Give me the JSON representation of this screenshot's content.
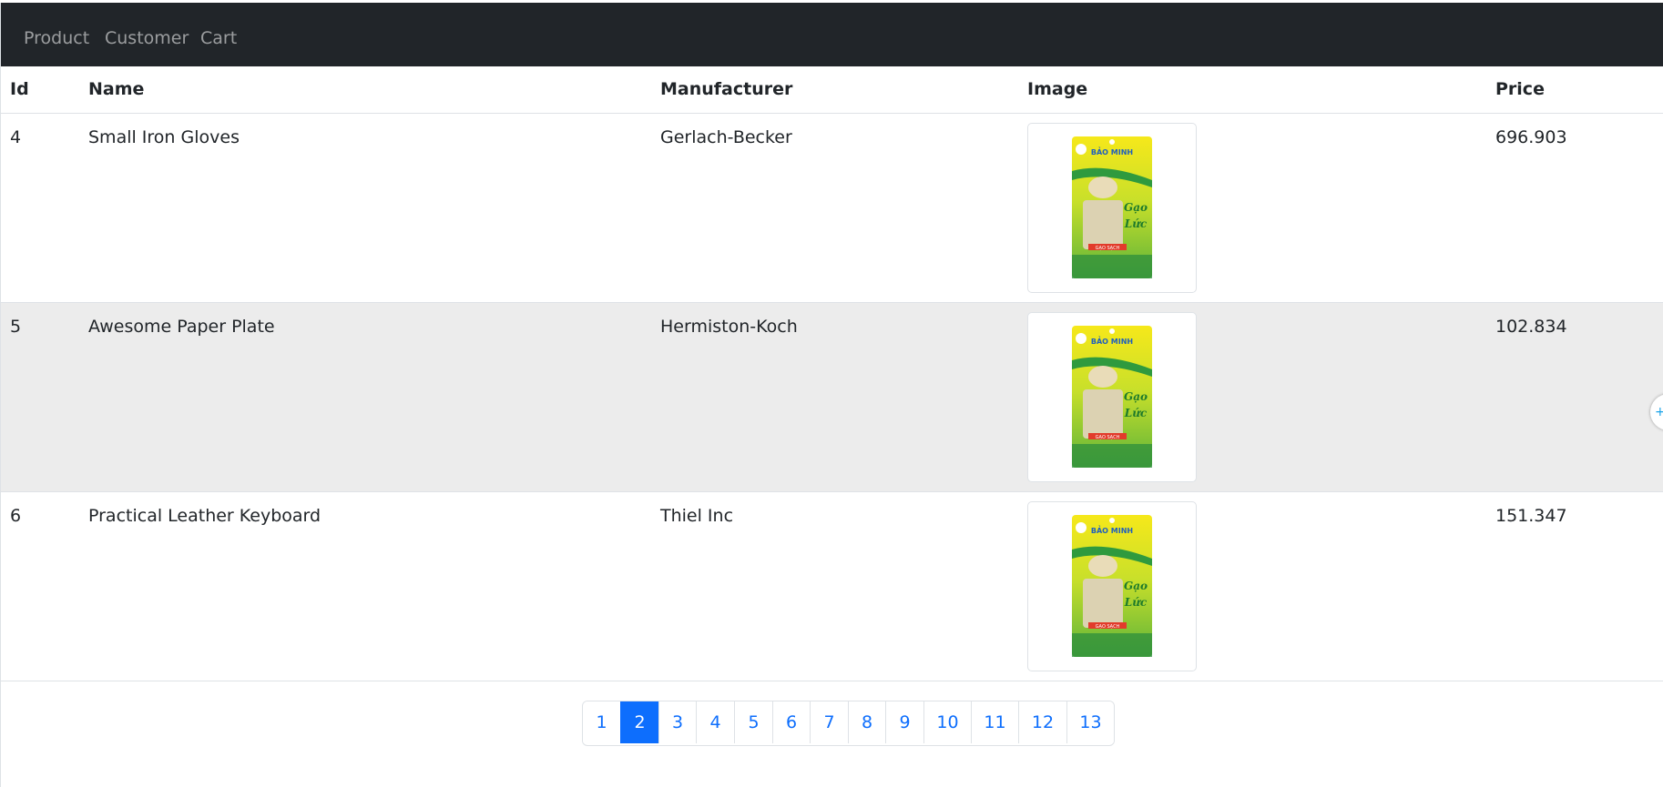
{
  "nav": {
    "links": [
      "Product",
      "Customer",
      "Cart"
    ],
    "background": "#212529"
  },
  "table": {
    "headers": [
      "Id",
      "Name",
      "Manufacturer",
      "Image",
      "Price"
    ],
    "rows": [
      {
        "id": "4",
        "name": "Small Iron Gloves",
        "manufacturer": "Gerlach-Becker",
        "image": "rice-bag-thumbnail",
        "price": "696.903"
      },
      {
        "id": "5",
        "name": "Awesome Paper Plate",
        "manufacturer": "Hermiston-Koch",
        "image": "rice-bag-thumbnail",
        "price": "102.834"
      },
      {
        "id": "6",
        "name": "Practical Leather Keyboard",
        "manufacturer": "Thiel Inc",
        "image": "rice-bag-thumbnail",
        "price": "151.347"
      }
    ],
    "stripe_color": "#ececec"
  },
  "product_image": {
    "label_top": "BẢO MINH",
    "label_main_1": "Gạo",
    "label_main_2": "Lức",
    "label_bottom": "GẠO SẠCH"
  },
  "pagination": {
    "pages": [
      "1",
      "2",
      "3",
      "4",
      "5",
      "6",
      "7",
      "8",
      "9",
      "10",
      "11",
      "12",
      "13"
    ],
    "active_page": "2",
    "accent": "#0d6efd"
  },
  "side_tab": {
    "icon": "plus-icon",
    "glyph": "+"
  }
}
